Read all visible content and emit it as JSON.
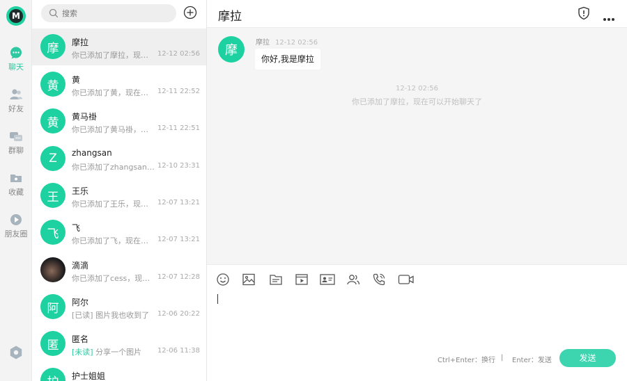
{
  "app": {
    "logo_letter": "M",
    "accent": "#1ed1a0"
  },
  "nav": {
    "items": [
      {
        "label": "聊天",
        "icon": "chat-bubble-icon"
      },
      {
        "label": "好友",
        "icon": "contacts-icon"
      },
      {
        "label": "群聊",
        "icon": "group-chat-icon"
      },
      {
        "label": "收藏",
        "icon": "favorites-folder-icon"
      },
      {
        "label": "朋友圈",
        "icon": "moments-icon"
      }
    ],
    "settings_icon": "settings-icon"
  },
  "search": {
    "placeholder": "搜索"
  },
  "conversations": [
    {
      "avatar": "摩",
      "name": "摩拉",
      "tag": "",
      "preview": "你已添加了摩拉，现在可以开始聊天了",
      "time": "12-12 02:56"
    },
    {
      "avatar": "黄",
      "name": "黄",
      "tag": "",
      "preview": "你已添加了黄，现在可以开始聊天了",
      "time": "12-11 22:52"
    },
    {
      "avatar": "黄",
      "name": "黄马褂",
      "tag": "",
      "preview": "你已添加了黄马褂，现在可以开始聊天了",
      "time": "12-11 22:51"
    },
    {
      "avatar": "Z",
      "name": "zhangsan",
      "tag": "",
      "preview": "你已添加了zhangsan，现在可以开始聊天了",
      "time": "12-10 23:31"
    },
    {
      "avatar": "王",
      "name": "王乐",
      "tag": "",
      "preview": "你已添加了王乐，现在可以开始聊天了",
      "time": "12-07 13:21"
    },
    {
      "avatar": "飞",
      "name": "飞",
      "tag": "",
      "preview": "你已添加了飞，现在可以开始聊天了",
      "time": "12-07 13:21"
    },
    {
      "avatar": "",
      "name": "滴滴",
      "tag": "",
      "preview": "你已添加了cess，现在可以开始聊天了",
      "time": "12-07 12:28"
    },
    {
      "avatar": "阿",
      "name": "阿尔",
      "tag": "[已读]",
      "preview": "图片我也收到了",
      "time": "12-06 20:22"
    },
    {
      "avatar": "匿",
      "name": "匿名",
      "tag": "[未读]",
      "preview": "分享一个图片",
      "time": "12-06 11:38"
    },
    {
      "avatar": "护",
      "name": "护士姐姐",
      "tag": "",
      "preview": "",
      "time": ""
    }
  ],
  "chat": {
    "title": "摩拉",
    "message": {
      "avatar": "摩",
      "sender": "摩拉",
      "time": "12-12 02:56",
      "text": "你好,我是摩拉"
    },
    "system": {
      "time": "12-12 02:56",
      "text": "你已添加了摩拉，现在可以开始聊天了"
    }
  },
  "composer": {
    "tools": [
      "emoji-icon",
      "image-icon",
      "file-icon",
      "video-file-icon",
      "contact-card-icon",
      "group-members-icon",
      "voice-call-icon",
      "video-call-icon"
    ],
    "hint_newline": "Ctrl+Enter：换行",
    "hint_separator": "|",
    "hint_send": "Enter：发送",
    "send_label": "发送"
  }
}
